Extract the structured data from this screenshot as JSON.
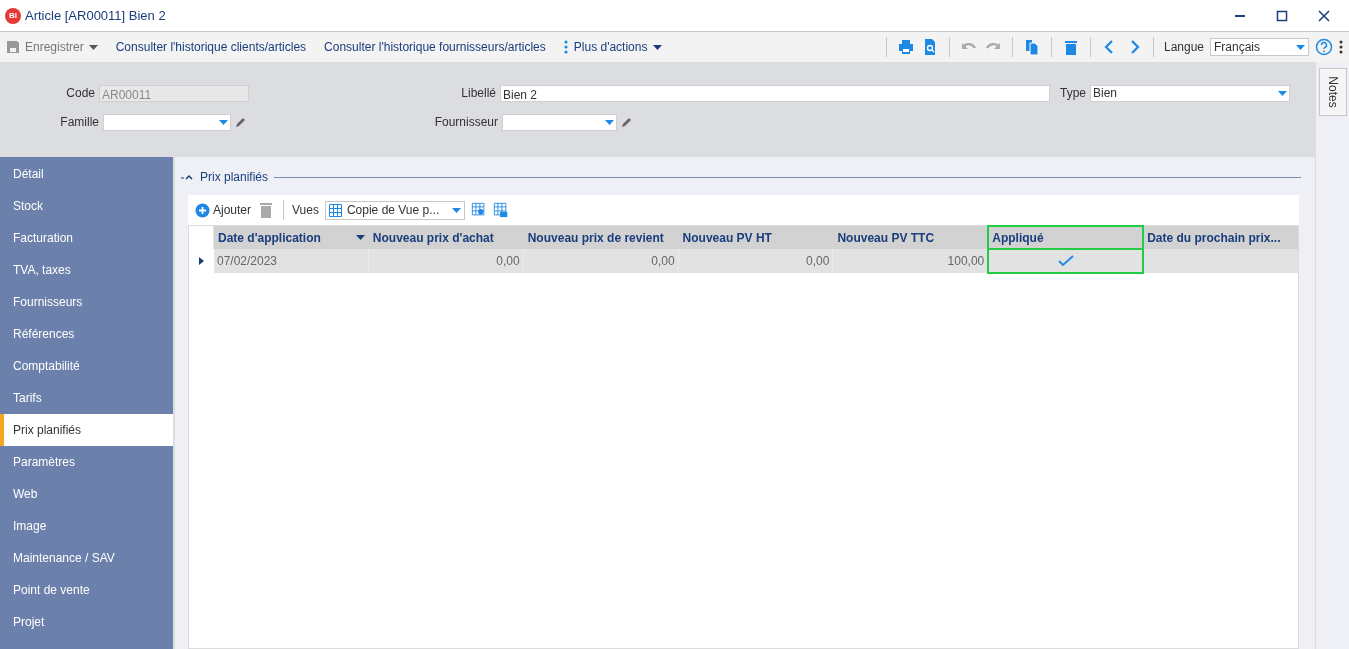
{
  "window": {
    "title": "Article [AR00011] Bien 2",
    "app_badge": "BI"
  },
  "toolbar": {
    "save": "Enregistrer",
    "actions": [
      "Consulter l'historique clients/articles",
      "Consulter l'historique fournisseurs/articles"
    ],
    "more": "Plus d'actions",
    "language_label": "Langue",
    "language": "Français"
  },
  "form": {
    "code_label": "Code",
    "code": "AR00011",
    "libelle_label": "Libellé",
    "libelle": "Bien 2",
    "type_label": "Type",
    "type": "Bien",
    "famille_label": "Famille",
    "fournisseur_label": "Fournisseur"
  },
  "notes_tab": "Notes",
  "sidebar": {
    "items": [
      {
        "label": "Détail",
        "selected": false
      },
      {
        "label": "Stock",
        "selected": false
      },
      {
        "label": "Facturation",
        "selected": false
      },
      {
        "label": "TVA, taxes",
        "selected": false
      },
      {
        "label": "Fournisseurs",
        "selected": false
      },
      {
        "label": "Références",
        "selected": false
      },
      {
        "label": "Comptabilité",
        "selected": false
      },
      {
        "label": "Tarifs",
        "selected": false
      },
      {
        "label": "Prix planifiés",
        "selected": true
      },
      {
        "label": "Paramètres",
        "selected": false
      },
      {
        "label": "Web",
        "selected": false
      },
      {
        "label": "Image",
        "selected": false
      },
      {
        "label": "Maintenance / SAV",
        "selected": false
      },
      {
        "label": "Point de vente",
        "selected": false
      },
      {
        "label": "Projet",
        "selected": false
      }
    ]
  },
  "section": {
    "title": "Prix planifiés",
    "expanded": true,
    "add": "Ajouter",
    "views_label": "Vues",
    "view": "Copie de Vue p..."
  },
  "table": {
    "columns": [
      {
        "label": "Date d'application",
        "highlighted": false
      },
      {
        "label": "Nouveau prix d'achat",
        "highlighted": false
      },
      {
        "label": "Nouveau prix de revient",
        "highlighted": false
      },
      {
        "label": "Nouveau PV HT",
        "highlighted": false
      },
      {
        "label": "Nouveau PV TTC",
        "highlighted": false
      },
      {
        "label": "Appliqué",
        "highlighted": true
      },
      {
        "label": "Date du prochain prix...",
        "highlighted": false
      }
    ],
    "rows": [
      {
        "selected": true,
        "date": "07/02/2023",
        "values": [
          "0,00",
          "0,00",
          "0,00",
          "100,00"
        ],
        "applied": true
      }
    ]
  }
}
